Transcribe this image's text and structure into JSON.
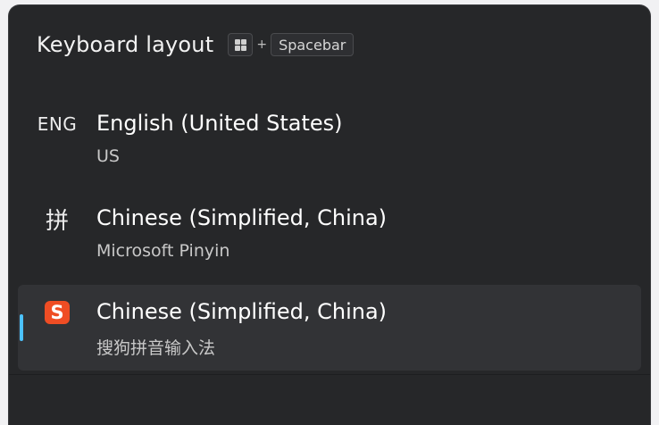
{
  "header": {
    "title": "Keyboard layout",
    "shortcut_plus": "+",
    "shortcut_key": "Spacebar",
    "windows_key_icon": "windows-logo-icon"
  },
  "layouts": [
    {
      "glyph": "ENG",
      "name": "English (United States)",
      "sub": "US",
      "selected": false
    },
    {
      "glyph": "拼",
      "name": "Chinese (Simplified, China)",
      "sub": "Microsoft Pinyin",
      "selected": false
    },
    {
      "glyph": "S",
      "glyph_icon": "sogou-logo-icon",
      "name": "Chinese (Simplified, China)",
      "sub": "搜狗拼音输入法",
      "selected": true
    }
  ],
  "colors": {
    "accent": "#4cc2ff",
    "background": "#262729",
    "selected": "#323336",
    "sogou": "#ef4d24"
  }
}
